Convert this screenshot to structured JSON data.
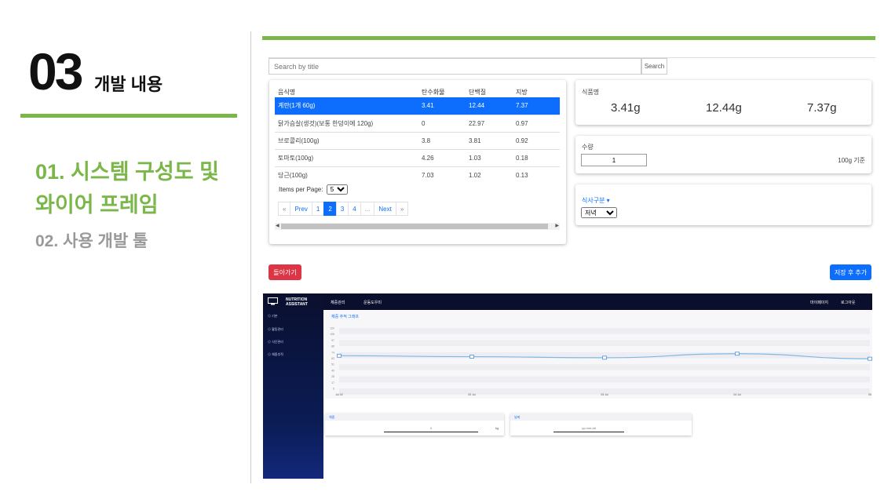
{
  "slide": {
    "number": "03",
    "section_title": "개발 내용",
    "menu": [
      {
        "label": "01. 시스템 구성도 및 와이어 프레임"
      },
      {
        "label": "02. 사용 개발 툴"
      }
    ],
    "accent_color": "#7ab648"
  },
  "search": {
    "placeholder": "Search by title",
    "button": "Search"
  },
  "food_table": {
    "headers": [
      "음식명",
      "탄수화물",
      "단백질",
      "지방"
    ],
    "rows": [
      [
        "계란(1개 60g)",
        "3.41",
        "12.44",
        "7.37"
      ],
      [
        "닭가슴살(생것)(보통 한덩이에 120g)",
        "0",
        "22.97",
        "0.97"
      ],
      [
        "브로콜리(100g)",
        "3.8",
        "3.81",
        "0.92"
      ],
      [
        "토마토(100g)",
        "4.26",
        "1.03",
        "0.18"
      ],
      [
        "당근(100g)",
        "7.03",
        "1.02",
        "0.13"
      ]
    ],
    "selected_row": 0,
    "items_per_page_label": "Items per Page:",
    "items_per_page": "5",
    "pagination": [
      "«",
      "Prev",
      "1",
      "2",
      "3",
      "4",
      "...",
      "Next",
      "»"
    ],
    "current_page": "2"
  },
  "nutrition": {
    "label": "식품명",
    "carbs": "3.41g",
    "protein": "12.44g",
    "fat": "7.37g"
  },
  "quantity": {
    "label": "수량",
    "value": "1",
    "unit": "100g 기준"
  },
  "meal": {
    "label": "식사구분 ▾",
    "selected": "저녁"
  },
  "buttons": {
    "back": "돌아가기",
    "save": "저장 후 추가"
  },
  "app": {
    "brand": "NUTRITION ASSISTANT",
    "sidebar": [
      "⊙ 기본",
      "⊙ 활동관리",
      "⊙ 식단관리",
      "⊙ 체중추적"
    ],
    "top_nav": [
      "체중관리",
      "운동도우미"
    ],
    "top_right": [
      "마이페이지",
      "로그아웃"
    ],
    "chart_title": "체중 추적 그래프",
    "weight_label": "체중",
    "weight_value": "0",
    "weight_unit": "kg",
    "date_label": "날짜",
    "date_placeholder": "yy-mm-dd"
  },
  "chart_data": {
    "type": "line",
    "title": "체중 추적 그래프",
    "x": [
      "Jul 02",
      "02 Jul",
      "03 Jul",
      "04 Jul",
      "05"
    ],
    "values": [
      65,
      63,
      61,
      69,
      59
    ],
    "ylim": [
      0,
      120
    ],
    "y_ticks": [
      "120",
      "108",
      "97",
      "85",
      "74",
      "63",
      "51",
      "40",
      "28",
      "17",
      "6"
    ],
    "series_color": "#7eb8e6",
    "grid": true
  }
}
